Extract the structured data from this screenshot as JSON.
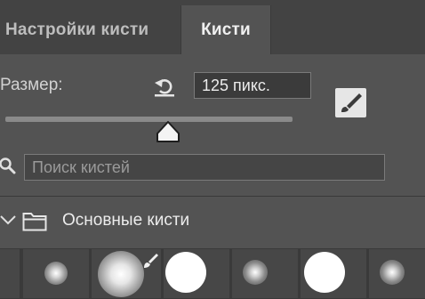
{
  "tabs": [
    {
      "label": "Настройки кисти",
      "active": false
    },
    {
      "label": "Кисти",
      "active": true
    }
  ],
  "size": {
    "label": "Размер:",
    "value": "125 пикс.",
    "slider_fraction": 0.56
  },
  "search": {
    "placeholder": "Поиск кистей"
  },
  "group": {
    "label": "Основные кисти",
    "expanded": true
  },
  "icons": {
    "reset": "reset-arrow-icon",
    "brush_toggle": "brush-settings-icon",
    "search": "search-icon",
    "chevron": "chevron-down-icon",
    "folder": "folder-icon",
    "brush_marker": "brush-marker-icon"
  },
  "brushes": [
    {
      "kind": "soft-small"
    },
    {
      "kind": "soft-large"
    },
    {
      "kind": "hard-large"
    },
    {
      "kind": "soft-small"
    },
    {
      "kind": "hard-large"
    },
    {
      "kind": "soft-small"
    }
  ],
  "colors": {
    "panel_bg": "#535353",
    "tab_bar_bg": "#434343",
    "field_bg": "#3b3b3b",
    "text": "#ececec"
  }
}
